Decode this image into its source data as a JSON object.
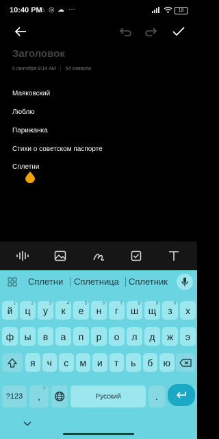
{
  "status_bar": {
    "time": "10:40 PM",
    "battery": "18",
    "more": "···"
  },
  "note": {
    "title_placeholder": "Заголовок",
    "date": "5 сентября 9:14 AM",
    "divider": "|",
    "char_count": "54 символа",
    "lines": [
      "Маяковский",
      "Люблю",
      "Парижанка",
      "Стихи о советском паспорте",
      "Сплетни"
    ]
  },
  "keyboard": {
    "suggestions": [
      "Сплетни",
      "Сплетница",
      "Сплетник"
    ],
    "row1": [
      {
        "k": "й",
        "h": "1"
      },
      {
        "k": "ц",
        "h": "2"
      },
      {
        "k": "у",
        "h": "3"
      },
      {
        "k": "к",
        "h": "4"
      },
      {
        "k": "е",
        "h": "5"
      },
      {
        "k": "н",
        "h": "6"
      },
      {
        "k": "г",
        "h": "7"
      },
      {
        "k": "ш",
        "h": "8"
      },
      {
        "k": "щ",
        "h": "9"
      },
      {
        "k": "з",
        "h": "0"
      },
      {
        "k": "х",
        "h": ""
      }
    ],
    "row2": [
      "ф",
      "ы",
      "в",
      "а",
      "п",
      "р",
      "о",
      "л",
      "д",
      "ж",
      "э"
    ],
    "row3": [
      "я",
      "ч",
      "с",
      "м",
      "и",
      "т",
      "ь",
      "б",
      "ю"
    ],
    "symbols_label": "?123",
    "comma_label": ",",
    "comma_hint": "☺",
    "space_label": "Русский",
    "period_label": "."
  }
}
